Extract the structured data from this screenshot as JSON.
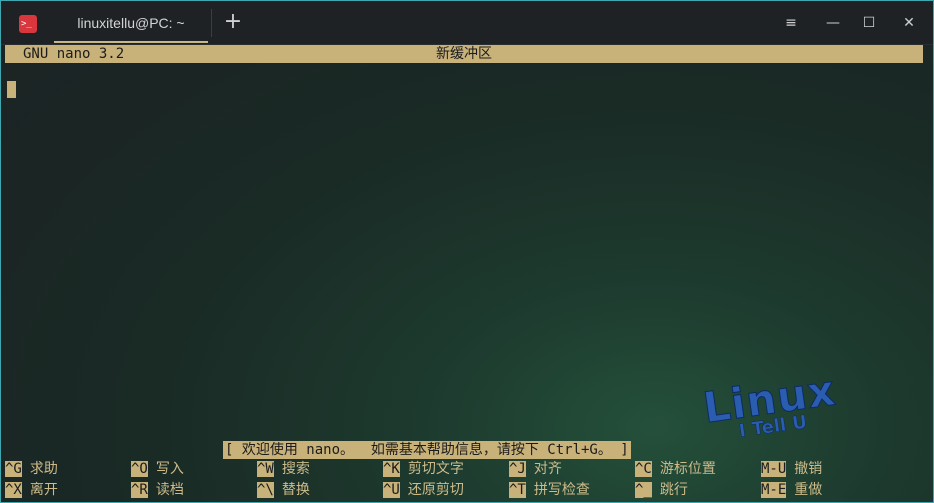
{
  "window": {
    "tab_title": "linuxitellu@PC: ~",
    "new_tab_label": "+",
    "menu_label": "≡",
    "minimize_label": "—",
    "maximize_label": "☐",
    "close_label": "✕",
    "app_icon_glyph": ">_"
  },
  "nano": {
    "version": "GNU nano 3.2",
    "buffer": "新缓冲区",
    "status": "[ 欢迎使用 nano。  如需基本帮助信息，请按下 Ctrl+G。 ]",
    "shortcuts": [
      {
        "key": "^G",
        "label": "求助"
      },
      {
        "key": "^O",
        "label": "写入"
      },
      {
        "key": "^W",
        "label": "搜索"
      },
      {
        "key": "^K",
        "label": "剪切文字"
      },
      {
        "key": "^J",
        "label": "对齐"
      },
      {
        "key": "^C",
        "label": "游标位置"
      },
      {
        "key": "M-U",
        "label": "撤销"
      },
      {
        "key": "^X",
        "label": "离开"
      },
      {
        "key": "^R",
        "label": "读档"
      },
      {
        "key": "^\\",
        "label": "替换"
      },
      {
        "key": "^U",
        "label": "还原剪切"
      },
      {
        "key": "^T",
        "label": "拼写检查"
      },
      {
        "key": "^_",
        "label": "跳行"
      },
      {
        "key": "M-E",
        "label": "重做"
      }
    ]
  },
  "watermark": {
    "line1": "Linux",
    "line2": "I Tell U"
  },
  "colors": {
    "accent": "#c8b27a",
    "app_icon": "#d9363e",
    "watermark": "#2a5db0"
  }
}
